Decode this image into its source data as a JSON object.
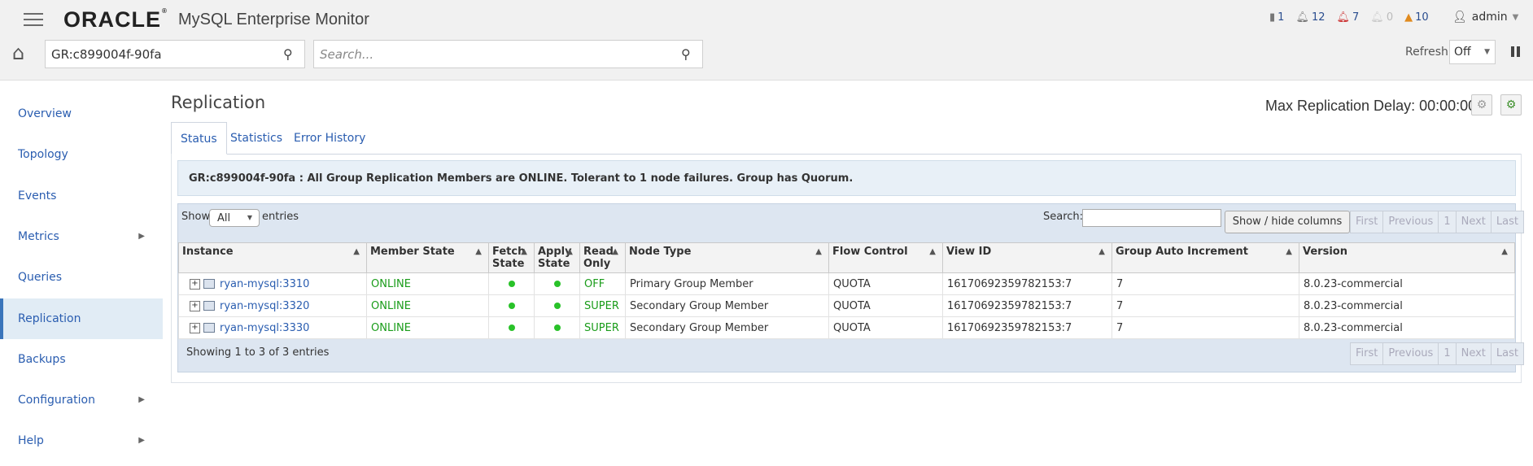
{
  "header": {
    "logo_oracle": "ORACLE",
    "logo_reg": "®",
    "product": "MySQL Enterprise Monitor",
    "status": {
      "servers": "1",
      "info": "12",
      "critical": "7",
      "emergency": "0",
      "warnings": "10"
    },
    "user": "admin",
    "group_filter": "GR:c899004f-90fa",
    "search_placeholder": "Search...",
    "refresh_label": "Refresh",
    "refresh_value": "Off"
  },
  "sidebar": {
    "items": [
      {
        "label": "Overview"
      },
      {
        "label": "Topology"
      },
      {
        "label": "Events"
      },
      {
        "label": "Metrics"
      },
      {
        "label": "Queries"
      },
      {
        "label": "Replication"
      },
      {
        "label": "Backups"
      },
      {
        "label": "Configuration"
      },
      {
        "label": "Help"
      }
    ]
  },
  "main": {
    "title": "Replication",
    "max_delay": "Max Replication Delay: 00:00:00",
    "tabs": [
      "Status",
      "Statistics",
      "Error History"
    ],
    "banner": "GR:c899004f-90fa : All Group Replication Members are ONLINE. Tolerant to 1 node failures. Group has Quorum.",
    "show_label": "Show",
    "show_value": "All",
    "entries_label": "entries",
    "search_label": "Search:",
    "show_hide_label": "Show / hide columns",
    "pager": [
      "First",
      "Previous",
      "1",
      "Next",
      "Last"
    ],
    "columns": [
      "Instance",
      "Member State",
      "Fetch State",
      "Apply State",
      "Read Only",
      "Node Type",
      "Flow Control",
      "View ID",
      "Group Auto Increment",
      "Version"
    ],
    "rows": [
      {
        "instance": "ryan-mysql:3310",
        "state": "ONLINE",
        "read_only": "OFF",
        "node_type": "Primary Group Member",
        "flow": "QUOTA",
        "view_id": "16170692359782153:7",
        "auto_inc": "7",
        "version": "8.0.23-commercial"
      },
      {
        "instance": "ryan-mysql:3320",
        "state": "ONLINE",
        "read_only": "SUPER",
        "node_type": "Secondary Group Member",
        "flow": "QUOTA",
        "view_id": "16170692359782153:7",
        "auto_inc": "7",
        "version": "8.0.23-commercial"
      },
      {
        "instance": "ryan-mysql:3330",
        "state": "ONLINE",
        "read_only": "SUPER",
        "node_type": "Secondary Group Member",
        "flow": "QUOTA",
        "view_id": "16170692359782153:7",
        "auto_inc": "7",
        "version": "8.0.23-commercial"
      }
    ],
    "showing": "Showing 1 to 3 of 3 entries"
  }
}
